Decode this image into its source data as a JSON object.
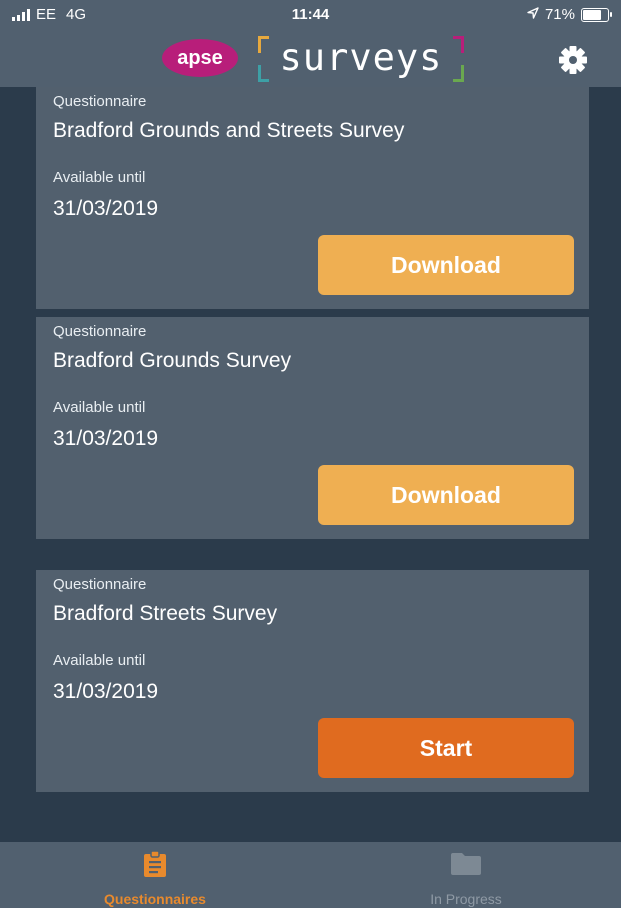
{
  "status_bar": {
    "carrier": "EE",
    "network": "4G",
    "time": "11:44",
    "battery": "71%"
  },
  "header": {
    "brand_badge": "apse",
    "brand_title": "surveys",
    "settings_icon": "gear-icon"
  },
  "cards": [
    {
      "type_label": "Questionnaire",
      "name": "Bradford Grounds and Streets Survey",
      "available_label": "Available until",
      "available_date": "31/03/2019",
      "action_label": "Download"
    },
    {
      "type_label": "Questionnaire",
      "name": "Bradford Grounds Survey",
      "available_label": "Available until",
      "available_date": "31/03/2019",
      "action_label": "Download"
    },
    {
      "type_label": "Questionnaire",
      "name": "Bradford Streets Survey",
      "available_label": "Available until",
      "available_date": "31/03/2019",
      "action_label": "Start"
    }
  ],
  "tabs": [
    {
      "label": "Questionnaires",
      "icon": "clipboard-icon",
      "active": true
    },
    {
      "label": "In Progress",
      "icon": "folder-icon",
      "active": false
    }
  ],
  "colors": {
    "header_bg": "#51606f",
    "page_bg": "#2b3b4b",
    "card_bg": "#52606e",
    "download_button": "#efaf52",
    "start_button": "#e06b1f",
    "active_tab": "#e88a2d",
    "apse_badge": "#b81e7a"
  }
}
